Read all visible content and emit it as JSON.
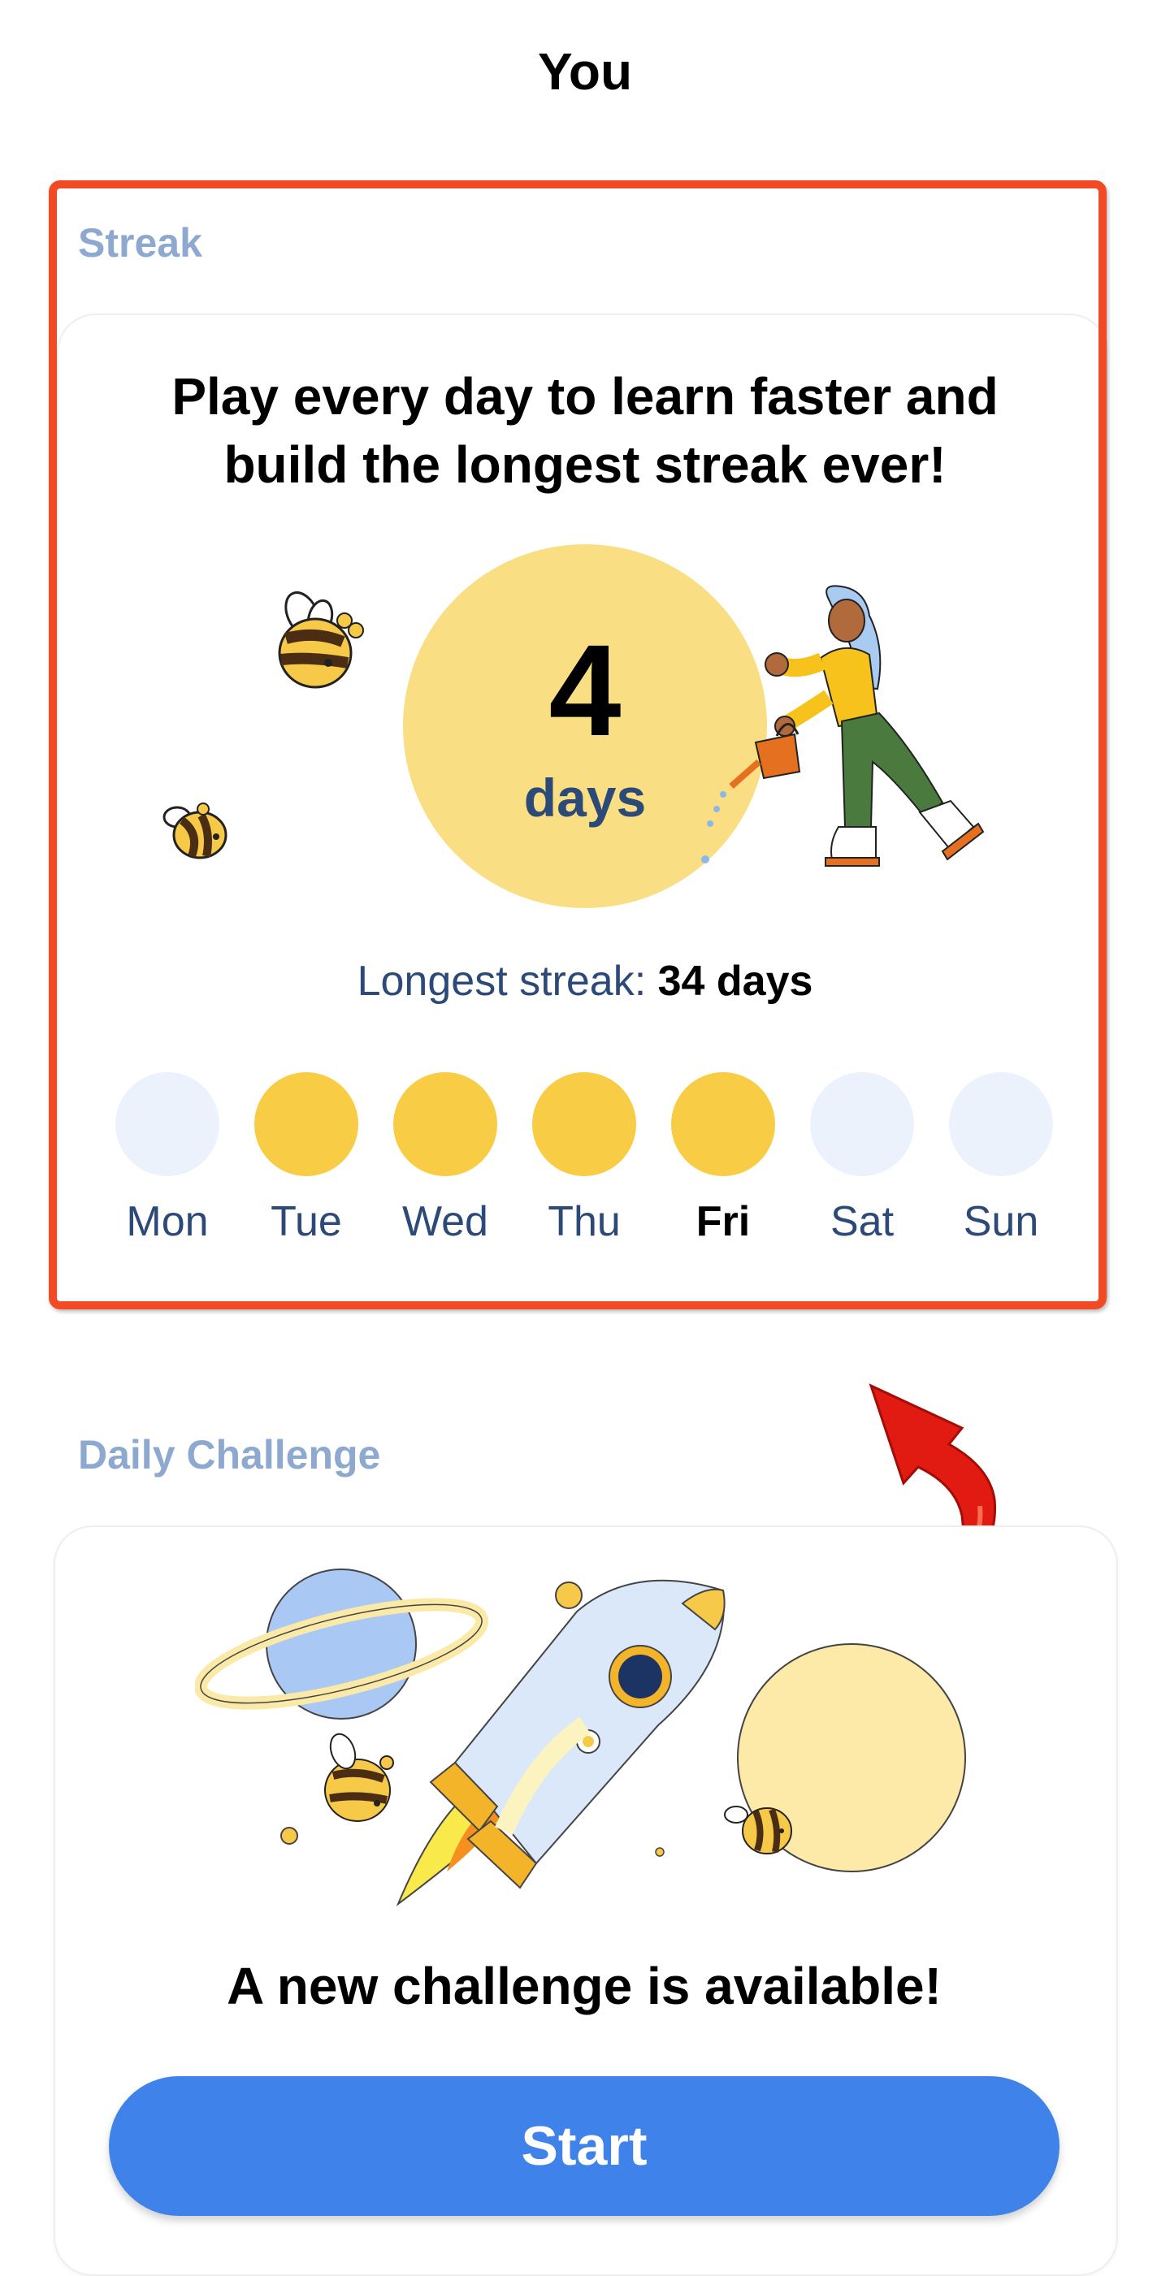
{
  "header": {
    "title": "You"
  },
  "streak": {
    "section_label": "Streak",
    "headline_line1": "Play every day to learn faster and",
    "headline_line2": "build the longest streak ever!",
    "count": "4",
    "unit": "days",
    "longest_label": "Longest streak:",
    "longest_value": "34 days",
    "days": [
      {
        "label": "Mon",
        "done": false,
        "today": false
      },
      {
        "label": "Tue",
        "done": true,
        "today": false
      },
      {
        "label": "Wed",
        "done": true,
        "today": false
      },
      {
        "label": "Thu",
        "done": true,
        "today": false
      },
      {
        "label": "Fri",
        "done": true,
        "today": true
      },
      {
        "label": "Sat",
        "done": false,
        "today": false
      },
      {
        "label": "Sun",
        "done": false,
        "today": false
      }
    ]
  },
  "daily_challenge": {
    "section_label": "Daily Challenge",
    "message": "A new challenge is available!",
    "start_label": "Start"
  },
  "colors": {
    "highlight": "#f24a24",
    "streak_circle": "#f9de84",
    "day_done": "#f9cc45",
    "day_todo": "#ebf2fc",
    "primary_button": "#3f82e9",
    "section_label": "#8ea9cf"
  }
}
